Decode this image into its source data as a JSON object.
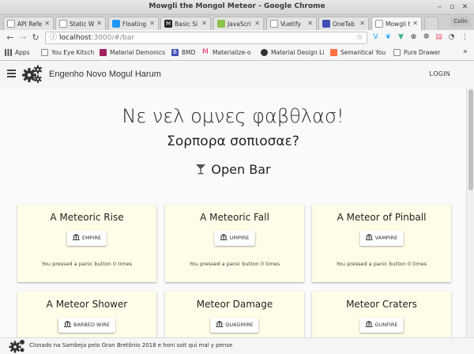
{
  "window": {
    "title": "Mowgli the Mongol Meteor - Google Chrome"
  },
  "tabs": [
    {
      "label": "API Refe",
      "color": "#f2f2f2"
    },
    {
      "label": "Static W",
      "color": "#f2f2f2"
    },
    {
      "label": "Floating",
      "color": "#2196f3"
    },
    {
      "label": "Basic Si",
      "color": "#222222"
    },
    {
      "label": "JavaScri",
      "color": "#8bc34a"
    },
    {
      "label": "Vuetify",
      "color": "#f2f2f2"
    },
    {
      "label": "OneTab",
      "color": "#3f51b5"
    },
    {
      "label": "Mowgli t",
      "color": "#f2f2f2"
    }
  ],
  "profile_label": "Colin",
  "address": {
    "host": "localhost",
    "path": ":3000/#/bar"
  },
  "bookmarks": [
    {
      "label": "Apps",
      "color": "#555555"
    },
    {
      "label": "You Eye Kitsch",
      "color": "#f6f6f6"
    },
    {
      "label": "Material Demonics",
      "color": "#a02060"
    },
    {
      "label": "BMD",
      "color": "#3f51b5"
    },
    {
      "label": "Materialize-o",
      "color": "#e91e63"
    },
    {
      "label": "Material Design Li",
      "color": "#333333"
    },
    {
      "label": "Semantical You",
      "color": "#ff7043"
    },
    {
      "label": "Pure Drawer",
      "color": "#f6f6f6"
    }
  ],
  "app": {
    "title": "Engenho Novo Mogul Harum",
    "login_label": "LOGIN"
  },
  "hero": {
    "headline": "Νε νελ ομνες φαβθλασ!",
    "subhead": "Σορπορα σοπιοσαε?",
    "section_title": "Open Bar"
  },
  "cards": [
    {
      "title": "A Meteoric Rise",
      "button": "EMPIRE",
      "note": "You pressed a panic button 0 times"
    },
    {
      "title": "A Meteoric Fall",
      "button": "UMPIRE",
      "note": "You pressed a panic button 0 times"
    },
    {
      "title": "A Meteor of Pinball",
      "button": "VAMPIRE",
      "note": "You pressed a panic button 0 times"
    },
    {
      "title": "A Meteor Shower",
      "button": "BARBED WIRE",
      "note": ""
    },
    {
      "title": "Meteor Damage",
      "button": "QUAGMIRE",
      "note": ""
    },
    {
      "title": "Meteor Craters",
      "button": "GUNFIRE",
      "note": ""
    }
  ],
  "footer": {
    "text": "Clonado na Sambeja pelo Gran Bretônio 2018 e honi soit qui mal y pense"
  }
}
